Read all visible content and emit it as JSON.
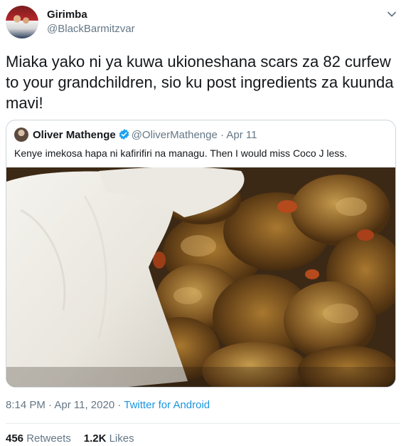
{
  "author": {
    "name": "Girimba",
    "handle": "@BlackBarmitzvar"
  },
  "tweet": {
    "text": "Miaka yako ni ya kuwa ukioneshana scars za 82 curfew to your grandchildren, sio ku post ingredients za kuunda mavi!"
  },
  "quoted": {
    "name": "Oliver Mathenge",
    "verified_icon": "verified-badge-icon",
    "handle": "@OliverMathenge",
    "separator": "·",
    "date": "Apr 11",
    "text": "Kenye imekosa hapa ni kafirifiri na managu. Then I would miss Coco J less.",
    "image_icon": "food-photo"
  },
  "meta": {
    "time": "8:14 PM",
    "separator": "·",
    "date": "Apr 11, 2020",
    "source": "Twitter for Android"
  },
  "stats": {
    "retweets_count": "456",
    "retweets_label": "Retweets",
    "likes_count": "1.2K",
    "likes_label": "Likes"
  },
  "colors": {
    "link": "#1b95e0",
    "secondary_text": "#657786",
    "primary_text": "#14171a",
    "border": "#ccd6dd"
  }
}
